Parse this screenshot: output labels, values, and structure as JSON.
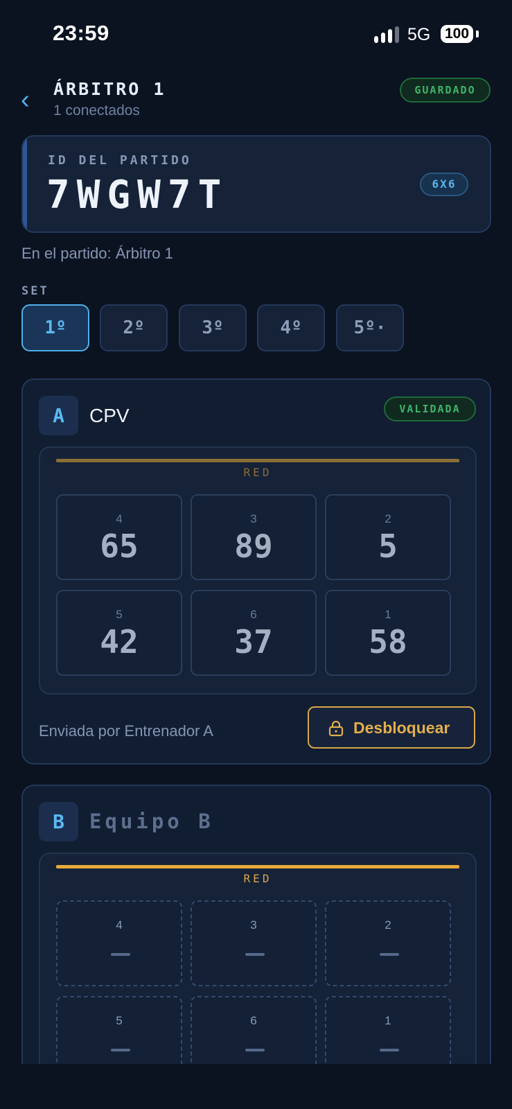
{
  "status_bar": {
    "time": "23:59",
    "network": "5G",
    "battery": "100"
  },
  "header": {
    "title": "ÁRBITRO 1",
    "subtitle": "1 conectados",
    "status_badge": "GUARDADO"
  },
  "match": {
    "label": "ID DEL PARTIDO",
    "id": "7WGW7T",
    "format_badge": "6X6",
    "in_match_text": "En el partido: Árbitro 1"
  },
  "sets": {
    "label": "SET",
    "items": [
      {
        "label": "1º",
        "active": true
      },
      {
        "label": "2º",
        "active": false
      },
      {
        "label": "3º",
        "active": false
      },
      {
        "label": "4º",
        "active": false
      },
      {
        "label": "5º·",
        "active": false
      }
    ]
  },
  "team_a": {
    "letter": "A",
    "name": "CPV",
    "status_badge": "VALIDADA",
    "net_label": "RED",
    "positions": [
      {
        "pos": "4",
        "player": "65"
      },
      {
        "pos": "3",
        "player": "89"
      },
      {
        "pos": "2",
        "player": "5"
      },
      {
        "pos": "5",
        "player": "42"
      },
      {
        "pos": "6",
        "player": "37"
      },
      {
        "pos": "1",
        "player": "58"
      }
    ],
    "sent_by": "Enviada por Entrenador A",
    "unlock_label": "Desbloquear"
  },
  "team_b": {
    "letter": "B",
    "name": "Equipo B",
    "net_label": "RED",
    "positions": [
      {
        "pos": "4",
        "player": ""
      },
      {
        "pos": "3",
        "player": ""
      },
      {
        "pos": "2",
        "player": ""
      },
      {
        "pos": "5",
        "player": ""
      },
      {
        "pos": "6",
        "player": ""
      },
      {
        "pos": "1",
        "player": ""
      }
    ]
  },
  "icons": {
    "back": "chevron-left-icon",
    "lock": "lock-icon",
    "signal": "cellular-signal-icon",
    "battery": "battery-icon"
  },
  "colors": {
    "background": "#0b1220",
    "accent": "#4fb0ea",
    "success": "#3fb36a",
    "warning": "#e2ae4d"
  }
}
